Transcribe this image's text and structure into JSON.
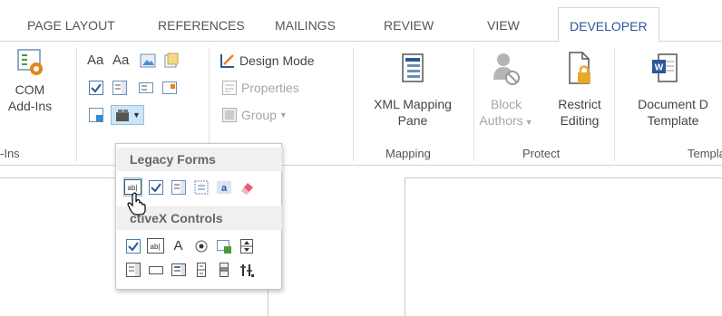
{
  "tabs": [
    {
      "label": "PAGE LAYOUT",
      "active": false
    },
    {
      "label": "REFERENCES",
      "active": false
    },
    {
      "label": "MAILINGS",
      "active": false
    },
    {
      "label": "REVIEW",
      "active": false
    },
    {
      "label": "VIEW",
      "active": false
    },
    {
      "label": "DEVELOPER",
      "active": true
    }
  ],
  "ribbon": {
    "addins": {
      "button": "COM\nAdd-Ins",
      "group_label": "-Ins"
    },
    "controls": {
      "design_mode": "Design Mode",
      "properties": "Properties",
      "group": "Group",
      "font_glyph": "Aa"
    },
    "mapping": {
      "button": "XML Mapping\nPane",
      "group_label": "Mapping"
    },
    "protect": {
      "block": "Block\nAuthors",
      "restrict": "Restrict\nEditing",
      "group_label": "Protect"
    },
    "templates": {
      "button": "Document D\nTemplate",
      "group_label": "Templa"
    }
  },
  "dropdown": {
    "legacy_header": "Legacy Forms",
    "activex_header": "ctiveX Controls",
    "text_field_glyph": "ab|",
    "label_glyph": "A"
  },
  "colors": {
    "accent": "#2b579a",
    "hover": "#cde6f7",
    "disabled": "#a6a6a6"
  }
}
